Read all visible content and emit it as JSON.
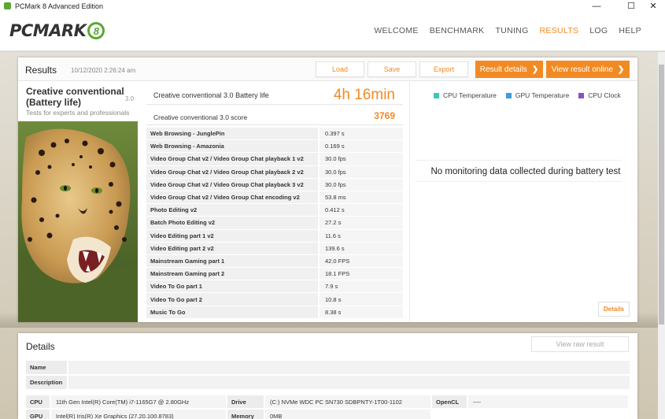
{
  "window": {
    "title": "PCMark 8 Advanced Edition",
    "minimize": "—",
    "maximize": "☐",
    "close": "✕"
  },
  "header": {
    "logo_text": "PCMARK",
    "logo_badge": "8",
    "nav": [
      {
        "label": "WELCOME",
        "active": false
      },
      {
        "label": "BENCHMARK",
        "active": false
      },
      {
        "label": "TUNING",
        "active": false
      },
      {
        "label": "RESULTS",
        "active": true
      },
      {
        "label": "LOG",
        "active": false
      },
      {
        "label": "HELP",
        "active": false
      }
    ]
  },
  "results": {
    "title": "Results",
    "date": "10/12/2020 2:26:24 am",
    "buttons": {
      "load": "Load",
      "save": "Save",
      "export": "Export",
      "result_details": "Result details",
      "view_online": "View result online",
      "chevron": "❯"
    },
    "test_name": "Creative conventional (Battery life)",
    "test_version": "3.0",
    "test_desc": "Tests for experts and professionals",
    "main_score_label": "Creative conventional 3.0 Battery life",
    "main_score_value": "4h 16min",
    "score_label": "Creative conventional 3.0 score",
    "score_value": "3769",
    "rows": [
      {
        "name": "Web Browsing - JunglePin",
        "value": "0.397 s"
      },
      {
        "name": "Web Browsing - Amazonia",
        "value": "0.169 s"
      },
      {
        "name": "Video Group Chat v2 / Video Group Chat playback 1 v2",
        "value": "30.0 fps"
      },
      {
        "name": "Video Group Chat v2 / Video Group Chat playback 2 v2",
        "value": "30.0 fps"
      },
      {
        "name": "Video Group Chat v2 / Video Group Chat playback 3 v2",
        "value": "30.0 fps"
      },
      {
        "name": "Video Group Chat v2 / Video Group Chat encoding v2",
        "value": "53.8 ms"
      },
      {
        "name": "Photo Editing v2",
        "value": "0.412 s"
      },
      {
        "name": "Batch Photo Editing v2",
        "value": "27.2 s"
      },
      {
        "name": "Video Editing part 1 v2",
        "value": "11.6 s"
      },
      {
        "name": "Video Editing part 2 v2",
        "value": "139.6 s"
      },
      {
        "name": "Mainstream Gaming part 1",
        "value": "42.0 FPS"
      },
      {
        "name": "Mainstream Gaming part 2",
        "value": "18.1 FPS"
      },
      {
        "name": "Video To Go part 1",
        "value": "7.9 s"
      },
      {
        "name": "Video To Go part 2",
        "value": "10.8 s"
      },
      {
        "name": "Music To Go",
        "value": "8.38 s"
      }
    ],
    "monitoring": {
      "legend": [
        {
          "label": "CPU Temperature",
          "color": "#3cc8b4"
        },
        {
          "label": "GPU Temperature",
          "color": "#3a9be0"
        },
        {
          "label": "CPU Clock",
          "color": "#8a4fc8"
        }
      ],
      "empty_text": "No monitoring data collected during battery test",
      "details_button": "Details"
    }
  },
  "details": {
    "title": "Details",
    "view_raw": "View raw result",
    "name_label": "Name",
    "description_label": "Description",
    "cpu_label": "CPU",
    "cpu_value": "11th Gen Intel(R) Core(TM) i7-1165G7 @ 2.80GHz",
    "drive_label": "Drive",
    "drive_value": "(C:) NVMe WDC PC SN730 SDBPNTY-1T00-1102",
    "opencl_label": "OpenCL",
    "opencl_value": "----",
    "gpu_label": "GPU",
    "gpu_value": "Intel(R) Iris(R) Xe Graphics (27.20.100.8783)",
    "memory_label": "Memory",
    "memory_value": "0MB"
  }
}
